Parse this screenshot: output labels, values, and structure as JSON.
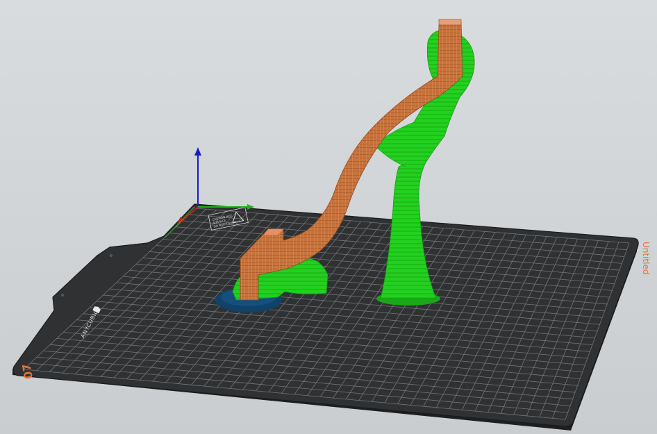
{
  "app": {
    "view": "3D preview"
  },
  "bed": {
    "brand_text": "ANYCUBIC",
    "corner_label": "07",
    "plate_name": "Untitled",
    "warning_lines": [
      "CAUTION HOT",
      "SURFACE",
      "DO NOT TOUCH"
    ]
  },
  "axes": {
    "x_color": "#c41e1e",
    "y_color": "#1fb01f",
    "z_color": "#1a1ad0"
  },
  "colors": {
    "support": "#22d11e",
    "model": "#c8733c",
    "raft": "#10426a",
    "bed_dark": "#2f3133",
    "grid": "#8a8d90",
    "accent_label": "#e3733a"
  }
}
